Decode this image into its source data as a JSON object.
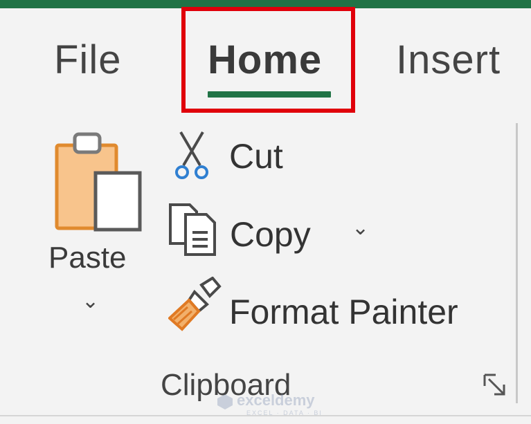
{
  "ribbon": {
    "tabs": [
      {
        "label": "File"
      },
      {
        "label": "Home",
        "active": true
      },
      {
        "label": "Insert"
      }
    ],
    "accent_color": "#217346",
    "highlight_color": "#e0000a"
  },
  "clipboard_group": {
    "label": "Clipboard",
    "paste": {
      "label": "Paste",
      "icon": "paste-clipboard-icon",
      "dropdown_icon": "chevron-down-icon"
    },
    "cut": {
      "label": "Cut",
      "icon": "scissors-icon"
    },
    "copy": {
      "label": "Copy",
      "icon": "copy-icon",
      "dropdown_icon": "chevron-down-icon"
    },
    "format_painter": {
      "label": "Format Painter",
      "icon": "paintbrush-icon"
    },
    "launcher_icon": "dialog-launcher-icon"
  },
  "watermark": {
    "name": "exceldemy",
    "tagline": "EXCEL · DATA · BI"
  }
}
